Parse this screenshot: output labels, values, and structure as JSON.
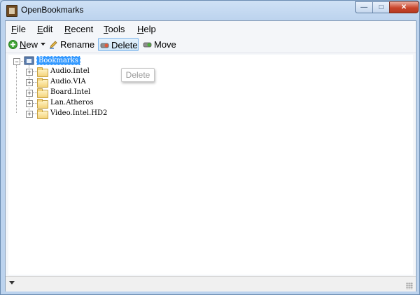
{
  "window": {
    "title": "OpenBookmarks",
    "controls": {
      "minimize": "—",
      "maximize": "□",
      "close": "✕"
    }
  },
  "menu": [
    {
      "label": "File",
      "mnemonic": "F",
      "rest": "ile"
    },
    {
      "label": "Edit",
      "mnemonic": "E",
      "rest": "dit"
    },
    {
      "label": "Recent",
      "mnemonic": "R",
      "rest": "ecent"
    },
    {
      "label": "Tools",
      "mnemonic": "T",
      "rest": "ools"
    },
    {
      "label": "Help",
      "mnemonic": "H",
      "rest": "elp"
    }
  ],
  "toolbar": {
    "new_label": "New",
    "new_mnemonic": "N",
    "new_rest": "ew",
    "rename_label": "Rename",
    "delete_label": "Delete",
    "move_label": "Move",
    "active": "Delete"
  },
  "tree": {
    "root": {
      "label": "Bookmarks",
      "expanded": true,
      "selected": true
    },
    "children": [
      {
        "label": "Audio.Intel"
      },
      {
        "label": "Audio.VIA"
      },
      {
        "label": "Board.Intel"
      },
      {
        "label": "Lan.Atheros"
      },
      {
        "label": "Video.Intel.HD2"
      }
    ],
    "expand_glyph": "+",
    "collapse_glyph": "−"
  },
  "tooltip": {
    "text": "Delete"
  },
  "colors": {
    "selection": "#3399ff",
    "frame": "#bcd3ee",
    "close_button": "#c9452b",
    "folder": "#f4d37a"
  }
}
